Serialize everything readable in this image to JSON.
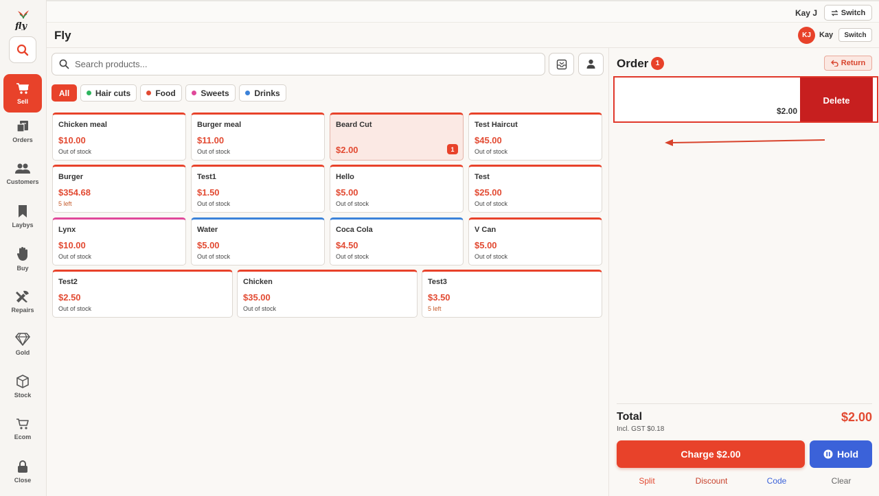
{
  "app": {
    "title": "Fly",
    "logo_text": "fly"
  },
  "topbar": {
    "user": "Kay J",
    "switch_label": "Switch"
  },
  "header": {
    "avatar_initials": "KJ",
    "user": "Kay",
    "switch_label": "Switch"
  },
  "sidebar": {
    "items": [
      {
        "label": "Sell",
        "icon": "cart-icon",
        "active": true
      },
      {
        "label": "Orders",
        "icon": "orders-icon"
      },
      {
        "label": "Customers",
        "icon": "customers-icon"
      },
      {
        "label": "Laybys",
        "icon": "bookmark-icon"
      },
      {
        "label": "Buy",
        "icon": "hand-icon"
      },
      {
        "label": "Repairs",
        "icon": "tools-icon"
      },
      {
        "label": "Gold",
        "icon": "diamond-icon"
      },
      {
        "label": "Stock",
        "icon": "box-icon"
      },
      {
        "label": "Ecom",
        "icon": "ecom-cart-icon"
      },
      {
        "label": "Close",
        "icon": "lock-icon"
      }
    ]
  },
  "search": {
    "placeholder": "Search products..."
  },
  "categories": [
    {
      "label": "All",
      "active": true
    },
    {
      "label": "Hair cuts",
      "color": "#2db55d"
    },
    {
      "label": "Food",
      "color": "#e24a32"
    },
    {
      "label": "Sweets",
      "color": "#e0489a"
    },
    {
      "label": "Drinks",
      "color": "#3b82d9"
    }
  ],
  "products": [
    {
      "name": "Chicken meal",
      "price": "$10.00",
      "stock": "Out of stock"
    },
    {
      "name": "Burger meal",
      "price": "$11.00",
      "stock": "Out of stock"
    },
    {
      "name": "Beard Cut",
      "price": "$2.00",
      "stock": "",
      "qty": "1"
    },
    {
      "name": "Test Haircut",
      "price": "$45.00",
      "stock": "Out of stock"
    },
    {
      "name": "Burger",
      "price": "$354.68",
      "stock": "5 left"
    },
    {
      "name": "Test1",
      "price": "$1.50",
      "stock": "Out of stock"
    },
    {
      "name": "Hello",
      "price": "$5.00",
      "stock": "Out of stock"
    },
    {
      "name": "Test",
      "price": "$25.00",
      "stock": "Out of stock"
    },
    {
      "name": "Lynx",
      "price": "$10.00",
      "stock": "Out of stock"
    },
    {
      "name": "Water",
      "price": "$5.00",
      "stock": "Out of stock"
    },
    {
      "name": "Coca Cola",
      "price": "$4.50",
      "stock": "Out of stock"
    },
    {
      "name": "V Can",
      "price": "$5.00",
      "stock": "Out of stock"
    },
    {
      "name": "Test2",
      "price": "$2.50",
      "stock": "Out of stock"
    },
    {
      "name": "Chicken",
      "price": "$35.00",
      "stock": "Out of stock"
    },
    {
      "name": "Test3",
      "price": "$3.50",
      "stock": "5 left"
    }
  ],
  "order": {
    "title": "Order",
    "count": "1",
    "return_label": "Return",
    "line_price": "$2.00",
    "delete_label": "Delete"
  },
  "totals": {
    "label": "Total",
    "gst": "Incl. GST $0.18",
    "amount": "$2.00",
    "charge_label": "Charge $2.00",
    "hold_label": "Hold"
  },
  "footer": {
    "split": "Split",
    "discount": "Discount",
    "code": "Code",
    "clear": "Clear"
  },
  "colors": {
    "accent": "#e8422a",
    "delete": "#c71f1f",
    "hold": "#3b62d9",
    "code_link": "#3b62d9"
  }
}
